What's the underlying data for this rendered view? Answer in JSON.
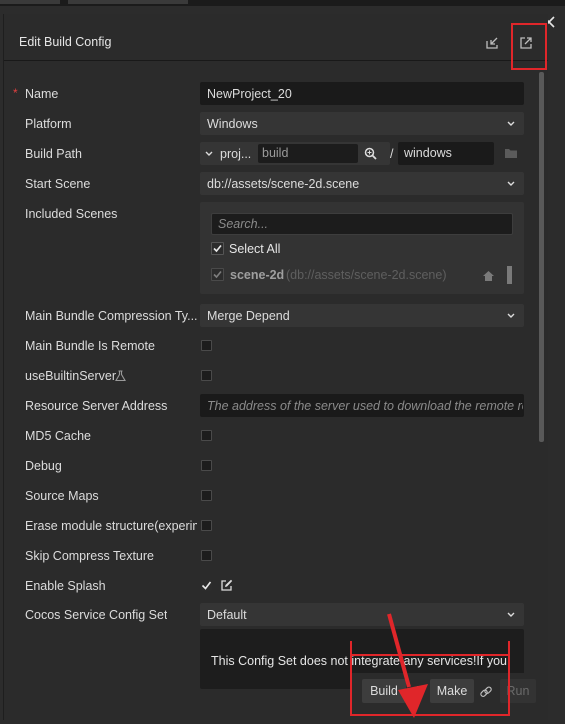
{
  "dialog": {
    "title": "Edit Build Config",
    "close_icon": "close-icon",
    "header_icons": [
      "import-icon",
      "export-icon"
    ]
  },
  "form": {
    "name": {
      "label": "Name",
      "required_mark": "*",
      "value": "NewProject_20"
    },
    "platform": {
      "label": "Platform",
      "value": "Windows"
    },
    "build_path": {
      "label": "Build Path",
      "prefix": "proj...",
      "dir_value": "build",
      "separator": "/",
      "sub_value": "windows"
    },
    "start_scene": {
      "label": "Start Scene",
      "value": "db://assets/scene-2d.scene"
    },
    "included_scenes": {
      "label": "Included Scenes",
      "search_placeholder": "Search...",
      "select_all_label": "Select All",
      "select_all_checked": true,
      "scenes": [
        {
          "name": "scene-2d",
          "path": "(db://assets/scene-2d.scene)",
          "checked": true
        }
      ]
    },
    "main_bundle_compression": {
      "label": "Main Bundle Compression Ty...",
      "value": "Merge Depend"
    },
    "main_bundle_is_remote": {
      "label": "Main Bundle Is Remote",
      "checked": false
    },
    "use_builtin_server": {
      "label": "useBuiltinServer",
      "checked": false
    },
    "resource_server_address": {
      "label": "Resource Server Address",
      "placeholder": "The address of the server used to download the remote resources"
    },
    "md5_cache": {
      "label": "MD5 Cache",
      "checked": false
    },
    "debug": {
      "label": "Debug",
      "checked": false
    },
    "source_maps": {
      "label": "Source Maps",
      "checked": false
    },
    "erase_module_structure": {
      "label": "Erase module structure(experimental)",
      "checked": false
    },
    "skip_compress_texture": {
      "label": "Skip Compress Texture",
      "checked": false
    },
    "enable_splash": {
      "label": "Enable Splash",
      "checked": true
    },
    "cocos_service_config_set": {
      "label": "Cocos Service Config Set",
      "value": "Default",
      "description": "This Config Set does not integrate any services!If you"
    }
  },
  "footer": {
    "build_label": "Build",
    "make_label": "Make",
    "run_label": "Run"
  }
}
